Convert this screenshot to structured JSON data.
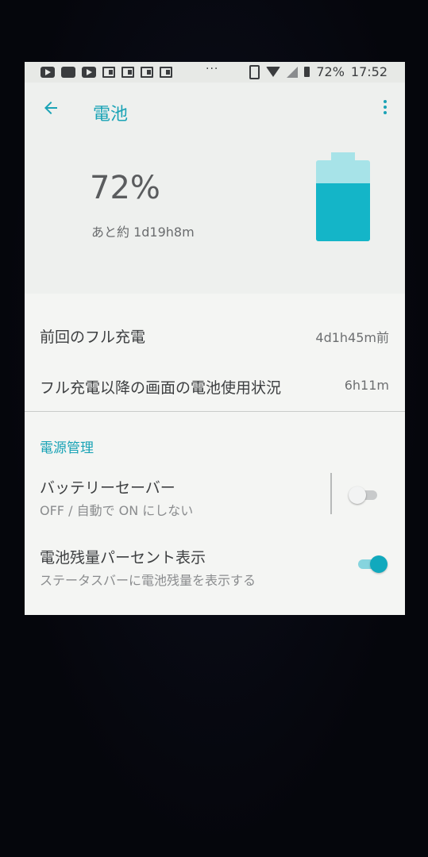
{
  "status_bar": {
    "left_icons": [
      "youtube-icon",
      "wnews-icon",
      "youtube-icon",
      "news-icon",
      "news-icon",
      "news-icon",
      "news-icon"
    ],
    "overflow": "···",
    "battery_percent": "72%",
    "time": "17:52"
  },
  "app_bar": {
    "title": "電池"
  },
  "battery": {
    "level_text": "72%",
    "level_fraction": 0.72,
    "remaining": "あと約 1d19h8m",
    "fill_color": "#14b5c8",
    "empty_color": "#a7e3e8"
  },
  "rows": {
    "last_full_charge": {
      "label": "前回のフル充電",
      "value": "4d1h45m前"
    },
    "screen_usage": {
      "label": "フル充電以降の画面の電池使用状況",
      "value": "6h11m"
    }
  },
  "power_management": {
    "section_title": "電源管理",
    "battery_saver": {
      "title": "バッテリーセーバー",
      "summary": "OFF / 自動で ON にしない",
      "enabled": false
    },
    "battery_percentage": {
      "title": "電池残量パーセント表示",
      "summary": "ステータスバーに電池残量を表示する",
      "enabled": true
    }
  },
  "colors": {
    "accent": "#1aa3b6"
  }
}
